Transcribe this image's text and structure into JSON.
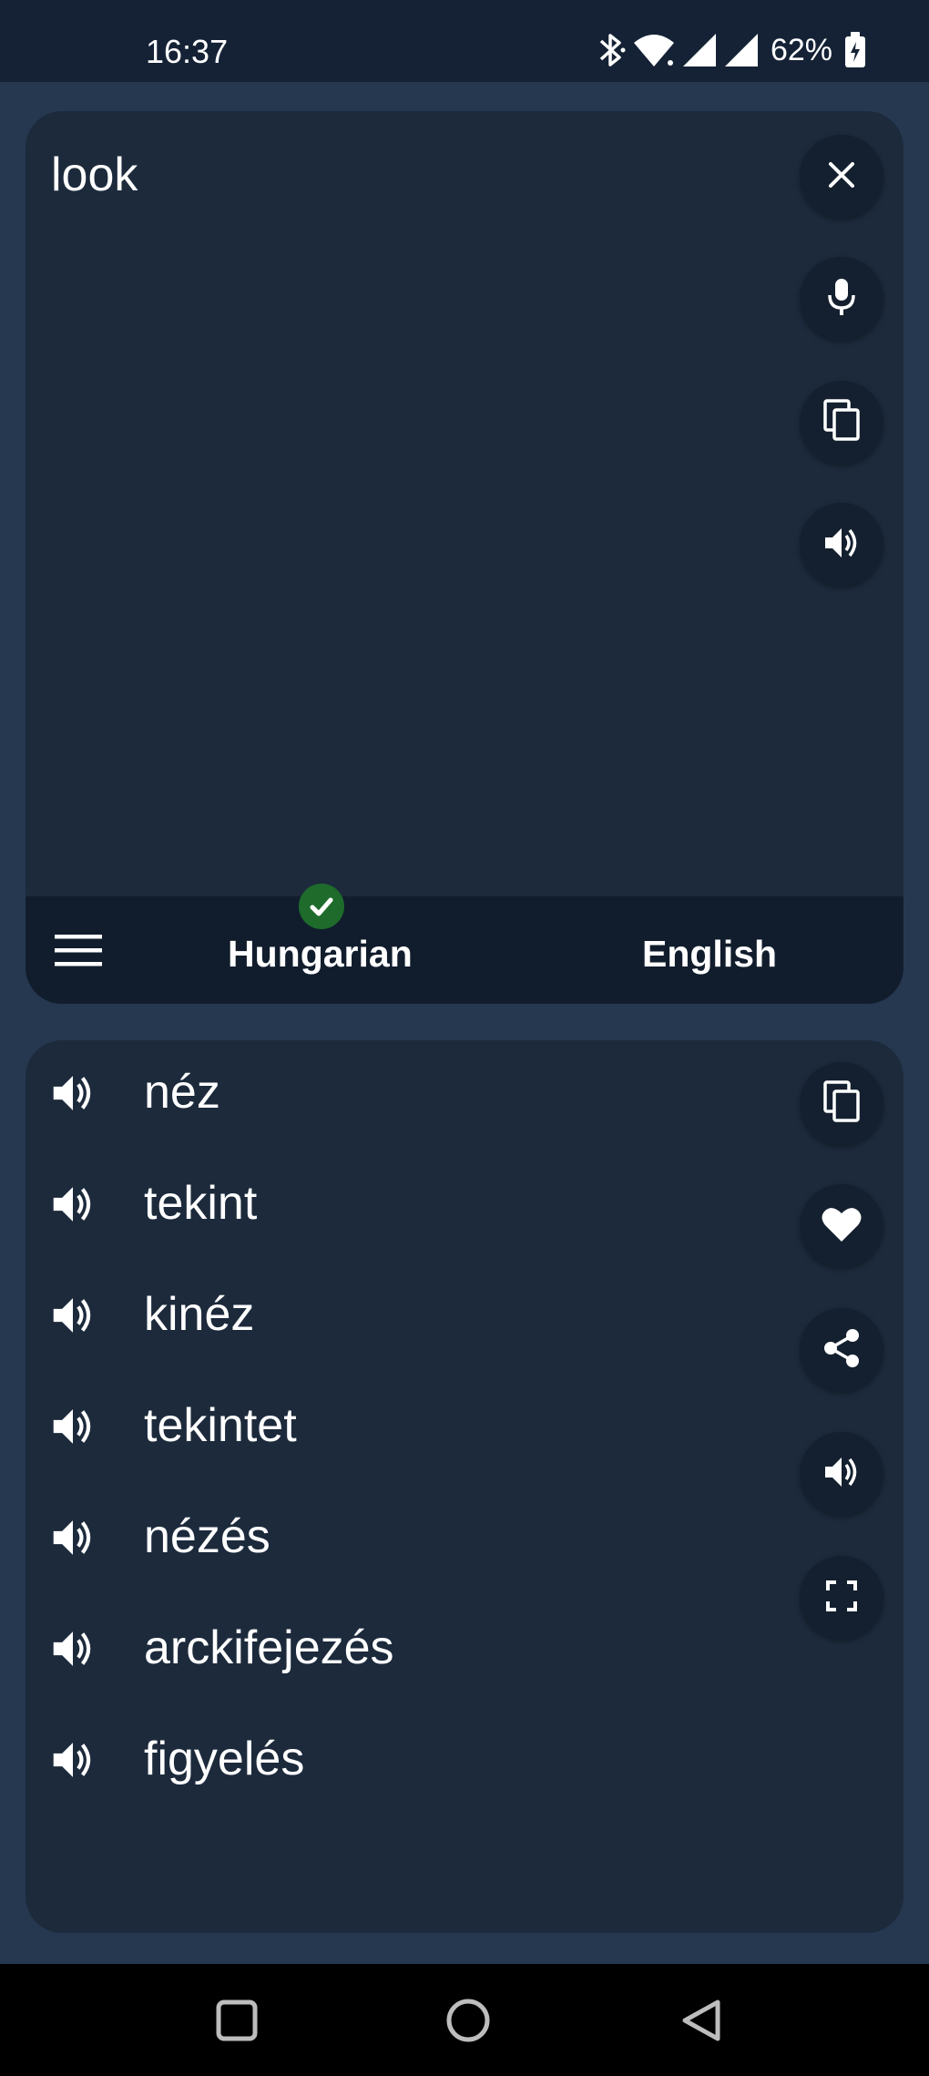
{
  "status": {
    "time": "16:37",
    "battery": "62%",
    "icons": [
      "bluetooth-icon",
      "wifi-icon",
      "signal-icon",
      "signal-icon",
      "battery-icon"
    ]
  },
  "input": {
    "text": "look",
    "actions": [
      "close-icon",
      "mic-icon",
      "copy-icon",
      "speaker-icon"
    ]
  },
  "languages": {
    "source": "Hungarian",
    "target": "English",
    "menu_icon": "menu-icon",
    "detected_icon": "check-icon"
  },
  "results": {
    "items": [
      {
        "word": "néz"
      },
      {
        "word": "tekint"
      },
      {
        "word": "kinéz"
      },
      {
        "word": "tekintet"
      },
      {
        "word": "nézés"
      },
      {
        "word": "arckifejezés"
      },
      {
        "word": "figyelés"
      }
    ],
    "actions": [
      "copy-icon",
      "heart-icon",
      "share-icon",
      "speaker-icon",
      "fullscreen-icon"
    ]
  },
  "navigation": [
    "recents-icon",
    "home-icon",
    "back-icon"
  ],
  "colors": {
    "background": "#263850",
    "card": "#1c2a3c",
    "status_bar": "#152236",
    "check": "#1e6b2c"
  }
}
